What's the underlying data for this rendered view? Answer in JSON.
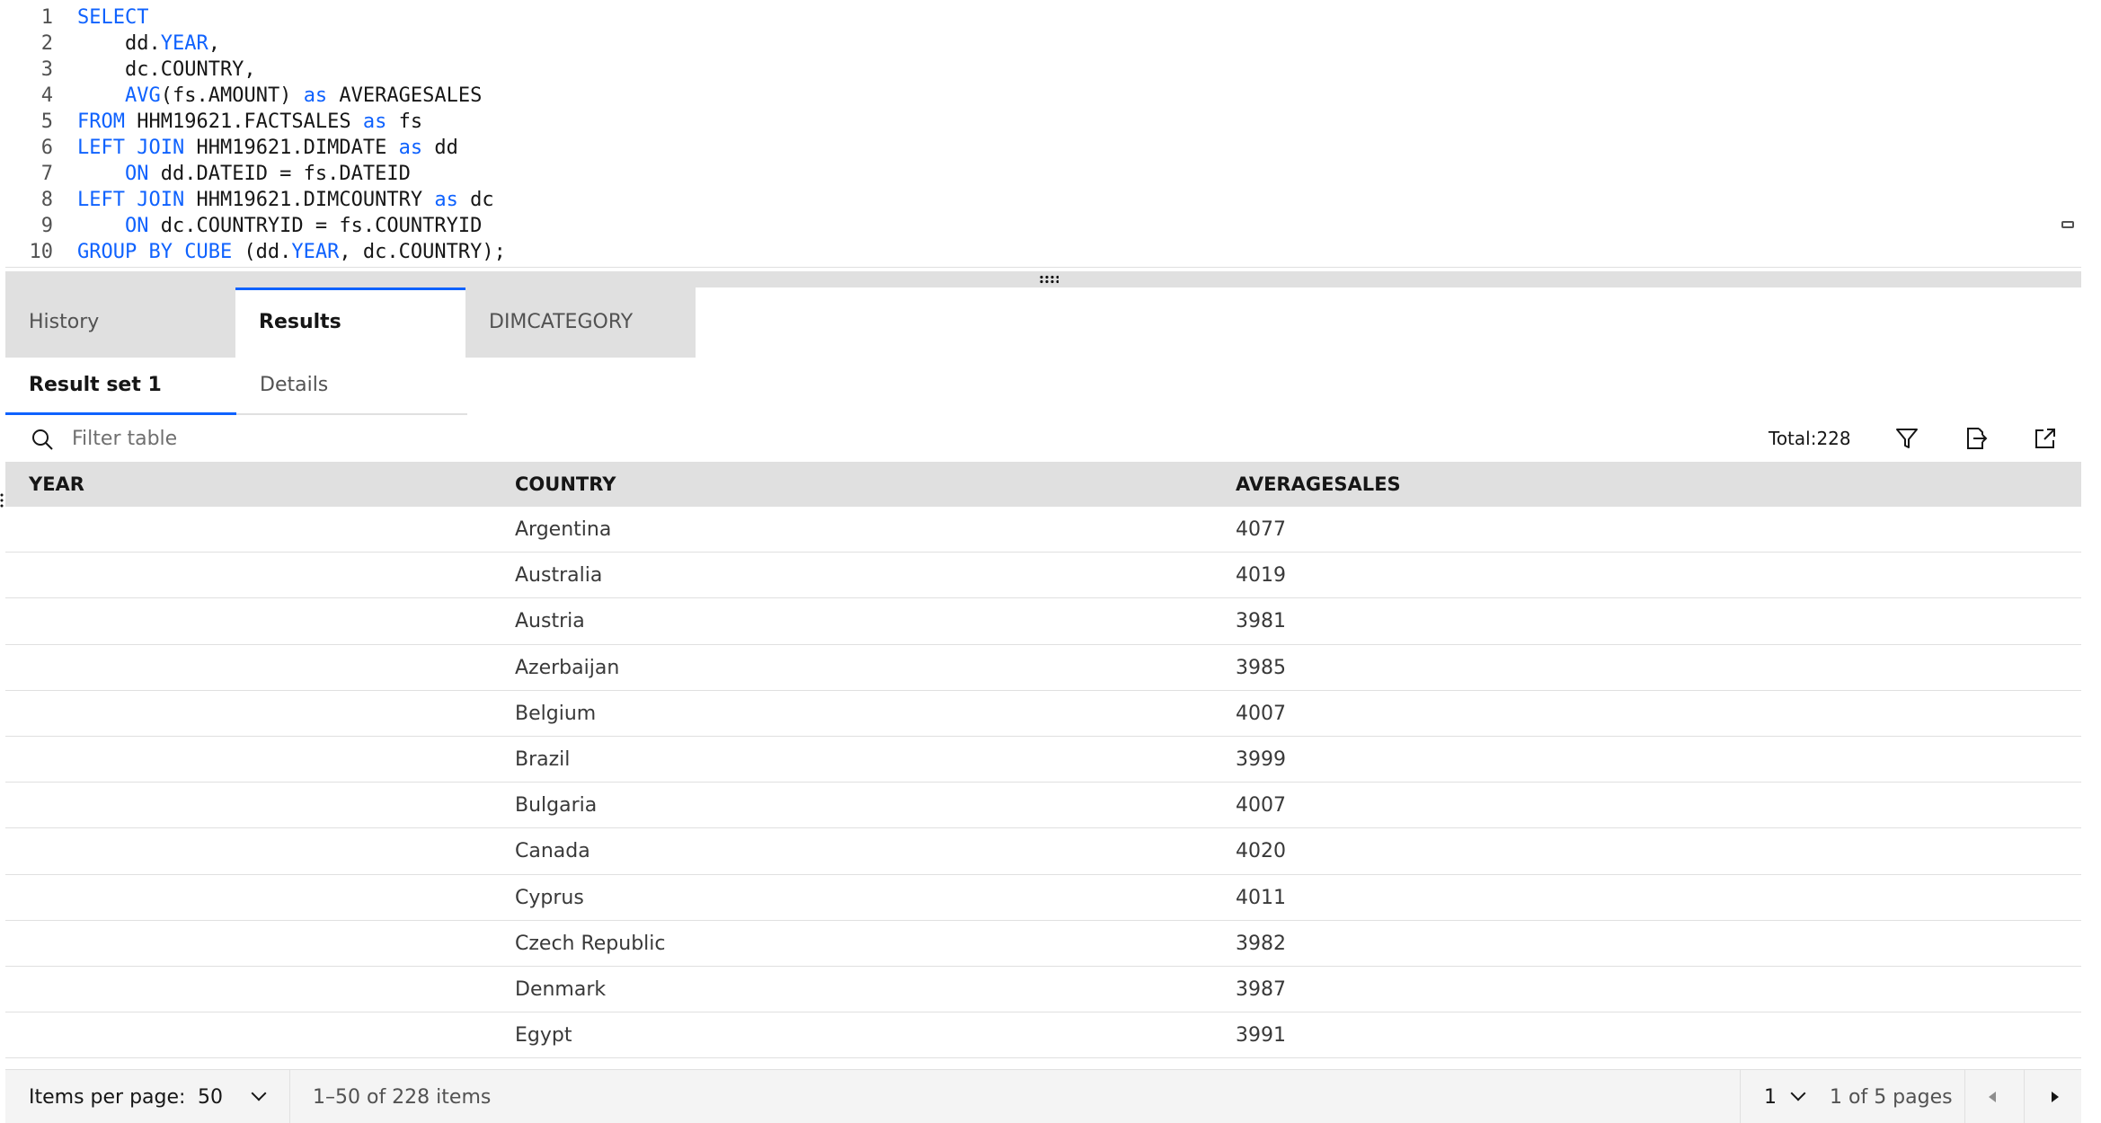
{
  "editor": {
    "lines": [
      {
        "n": "1",
        "parts": [
          {
            "t": "SELECT",
            "k": true
          }
        ]
      },
      {
        "n": "2",
        "parts": [
          {
            "t": "    dd.",
            "k": false
          },
          {
            "t": "YEAR",
            "k": true
          },
          {
            "t": ",",
            "k": false
          }
        ]
      },
      {
        "n": "3",
        "parts": [
          {
            "t": "    dc.COUNTRY,",
            "k": false
          }
        ]
      },
      {
        "n": "4",
        "parts": [
          {
            "t": "    ",
            "k": false
          },
          {
            "t": "AVG",
            "k": true
          },
          {
            "t": "(fs.AMOUNT) ",
            "k": false
          },
          {
            "t": "as",
            "k": true
          },
          {
            "t": " AVERAGESALES",
            "k": false
          }
        ]
      },
      {
        "n": "5",
        "parts": [
          {
            "t": "FROM",
            "k": true
          },
          {
            "t": " HHM19621.FACTSALES ",
            "k": false
          },
          {
            "t": "as",
            "k": true
          },
          {
            "t": " fs",
            "k": false
          }
        ]
      },
      {
        "n": "6",
        "parts": [
          {
            "t": "LEFT JOIN",
            "k": true
          },
          {
            "t": " HHM19621.DIMDATE ",
            "k": false
          },
          {
            "t": "as",
            "k": true
          },
          {
            "t": " dd",
            "k": false
          }
        ]
      },
      {
        "n": "7",
        "parts": [
          {
            "t": "    ",
            "k": false
          },
          {
            "t": "ON",
            "k": true
          },
          {
            "t": " dd.DATEID = fs.DATEID",
            "k": false
          }
        ]
      },
      {
        "n": "8",
        "parts": [
          {
            "t": "LEFT JOIN",
            "k": true
          },
          {
            "t": " HHM19621.DIMCOUNTRY ",
            "k": false
          },
          {
            "t": "as",
            "k": true
          },
          {
            "t": " dc",
            "k": false
          }
        ]
      },
      {
        "n": "9",
        "parts": [
          {
            "t": "    ",
            "k": false
          },
          {
            "t": "ON",
            "k": true
          },
          {
            "t": " dc.COUNTRYID = fs.COUNTRYID",
            "k": false
          }
        ]
      },
      {
        "n": "10",
        "parts": [
          {
            "t": "GROUP BY CUBE",
            "k": true
          },
          {
            "t": " (dd.",
            "k": false
          },
          {
            "t": "YEAR",
            "k": true
          },
          {
            "t": ", dc.COUNTRY);",
            "k": false
          }
        ]
      }
    ]
  },
  "tabs": [
    {
      "label": "History",
      "active": false
    },
    {
      "label": "Results",
      "active": true
    },
    {
      "label": "DIMCATEGORY",
      "active": false
    }
  ],
  "subtabs": [
    {
      "label": "Result set 1",
      "active": true
    },
    {
      "label": "Details",
      "active": false
    }
  ],
  "toolbar": {
    "filter_placeholder": "Filter table",
    "total": "Total:228",
    "icons": [
      "search-icon",
      "filter-icon",
      "export-icon",
      "open-external-icon"
    ]
  },
  "table": {
    "columns": [
      "YEAR",
      "COUNTRY",
      "AVERAGESALES"
    ],
    "rows": [
      [
        "",
        "Argentina",
        "4077"
      ],
      [
        "",
        "Australia",
        "4019"
      ],
      [
        "",
        "Austria",
        "3981"
      ],
      [
        "",
        "Azerbaijan",
        "3985"
      ],
      [
        "",
        "Belgium",
        "4007"
      ],
      [
        "",
        "Brazil",
        "3999"
      ],
      [
        "",
        "Bulgaria",
        "4007"
      ],
      [
        "",
        "Canada",
        "4020"
      ],
      [
        "",
        "Cyprus",
        "4011"
      ],
      [
        "",
        "Czech Republic",
        "3982"
      ],
      [
        "",
        "Denmark",
        "3987"
      ],
      [
        "",
        "Egypt",
        "3991"
      ]
    ]
  },
  "pagination": {
    "items_per_page_label": "Items per page:",
    "items_per_page": "50",
    "range": "1–50 of 228 items",
    "page": "1",
    "page_of": "1 of 5 pages"
  },
  "colors": {
    "accent": "#0f62fe",
    "keyword": "#0f62fe",
    "header_bg": "#e0e0e0"
  }
}
